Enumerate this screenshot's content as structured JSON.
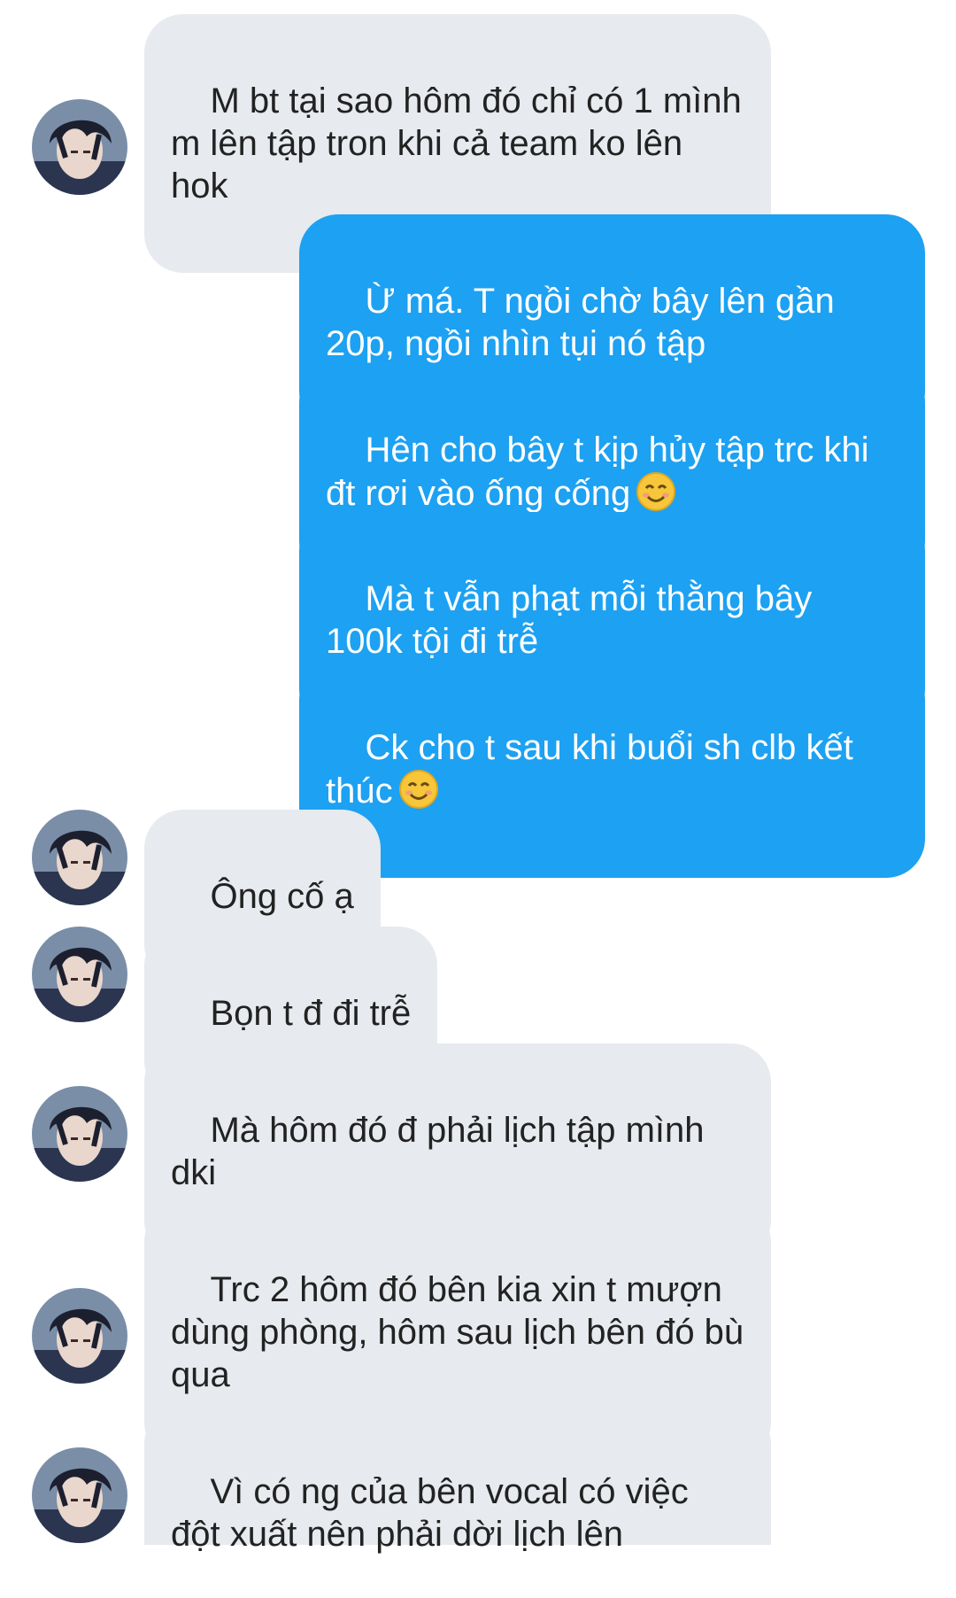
{
  "messages": [
    {
      "side": "in",
      "text": "M bt tại sao hôm đó chỉ có 1 mình m lên tập tron khi cả team ko lên hok"
    },
    {
      "side": "out",
      "text": "Ừ má. T ngồi chờ bây lên gần 20p, ngồi nhìn tụi nó tập"
    },
    {
      "side": "out",
      "text": "Hên cho bây t kịp hủy tập trc khi đt rơi vào ống cống",
      "emoji": "smiling-face-icon"
    },
    {
      "side": "out",
      "text": "Mà t vẫn phạt mỗi thằng bây 100k tội đi trễ"
    },
    {
      "side": "out",
      "text": "Ck cho t sau khi buổi sh clb kết thúc",
      "emoji": "smiling-face-icon"
    },
    {
      "side": "in",
      "text": "Ông cố ạ"
    },
    {
      "side": "in",
      "text": "Bọn t đ đi trễ"
    },
    {
      "side": "in",
      "text": "Mà hôm đó đ phải lịch tập mình dki"
    },
    {
      "side": "in",
      "text": "Trc 2 hôm đó bên kia xin t mượn dùng phòng, hôm sau lịch bên đó bù qua"
    },
    {
      "side": "in",
      "text": "Vì có ng của bên vocal có việc đột xuất nên phải dời lịch lên"
    }
  ],
  "colors": {
    "incoming_bubble": "#e7eaee",
    "incoming_text": "#222222",
    "outgoing_bubble": "#1da1f2",
    "outgoing_text": "#ffffff",
    "background": "#ffffff"
  }
}
